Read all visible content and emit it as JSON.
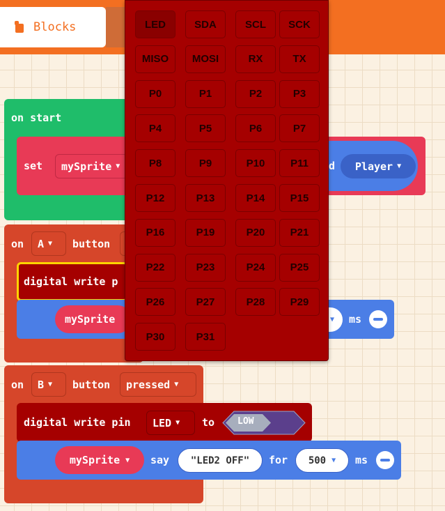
{
  "tabs": {
    "blocks_label": "Blocks"
  },
  "pins": [
    "LED",
    "SDA",
    "SCL",
    "SCK",
    "MISO",
    "MOSI",
    "RX",
    "TX",
    "P0",
    "P1",
    "P2",
    "P3",
    "P4",
    "P5",
    "P6",
    "P7",
    "P8",
    "P9",
    "P10",
    "P11",
    "P12",
    "P13",
    "P14",
    "P15",
    "P16",
    "P19",
    "P20",
    "P21",
    "P22",
    "P23",
    "P24",
    "P25",
    "P26",
    "P27",
    "P28",
    "P29",
    "P30",
    "P31"
  ],
  "selected_pin": "LED",
  "blocks": {
    "on_start": {
      "label": "on start",
      "set_label": "set",
      "variable": "mySprite",
      "kind_label": "d",
      "kind_value": "Player"
    },
    "on_a": {
      "on_label": "on",
      "button_value": "A",
      "button_label": "button",
      "digital_write_label": "digital write p",
      "sprite": "mySprite",
      "ms_label": "ms"
    },
    "on_b": {
      "on_label": "on",
      "button_value": "B",
      "button_label": "button",
      "event_value": "pressed",
      "digital_write_label": "digital write pin",
      "pin_value": "LED",
      "to_label": "to",
      "level_value": "LOW",
      "sprite": "mySprite",
      "say_label": "say",
      "say_text": "\"LED2 OFF\"",
      "for_label": "for",
      "for_value": "500",
      "ms_label": "ms"
    }
  },
  "colors": {
    "topbar": "#f36f21",
    "loops_green": "#1fbd6a",
    "event_orange": "#d6462a",
    "pins_red": "#a50000",
    "sprite_blue": "#4b7ee6",
    "var_red": "#e83a56"
  }
}
